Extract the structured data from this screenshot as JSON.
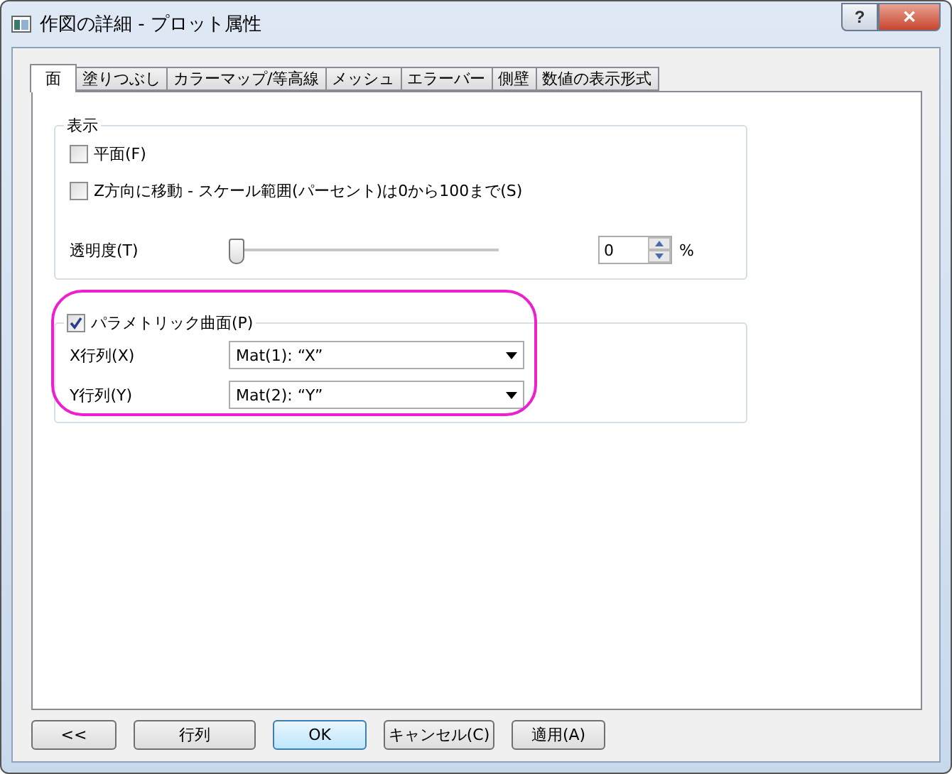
{
  "window": {
    "title": "作図の詳細 - プロット属性",
    "help": "?",
    "close": "✕"
  },
  "tabs": [
    {
      "label": "面",
      "selected": true
    },
    {
      "label": "塗りつぶし",
      "selected": false
    },
    {
      "label": "カラーマップ/等高線",
      "selected": false
    },
    {
      "label": "メッシュ",
      "selected": false
    },
    {
      "label": "エラーバー",
      "selected": false
    },
    {
      "label": "側壁",
      "selected": false
    },
    {
      "label": "数値の表示形式",
      "selected": false
    }
  ],
  "display_group": {
    "title": "表示",
    "checkboxes": [
      {
        "label": "平面(F)",
        "checked": false
      },
      {
        "label": "Z方向に移動 - スケール範囲(パーセント)は0から100まで(S)",
        "checked": false
      }
    ],
    "transparency": {
      "label": "透明度(T)",
      "level": 0,
      "value": "0",
      "unit": "%"
    }
  },
  "parametric_group": {
    "label": "パラメトリック曲面(P)",
    "checked": true,
    "highlighted": true,
    "rows": [
      {
        "label": "X行列(X)",
        "value": "Mat(1): “X”"
      },
      {
        "label": "Y行列(Y)",
        "value": "Mat(2): “Y”"
      }
    ]
  },
  "buttons": [
    {
      "label": "<<",
      "default": false
    },
    {
      "label": "行列",
      "default": false
    },
    {
      "label": "OK",
      "default": true
    },
    {
      "label": "キャンセル(C)",
      "default": false
    },
    {
      "label": "適用(A)",
      "default": false
    }
  ]
}
